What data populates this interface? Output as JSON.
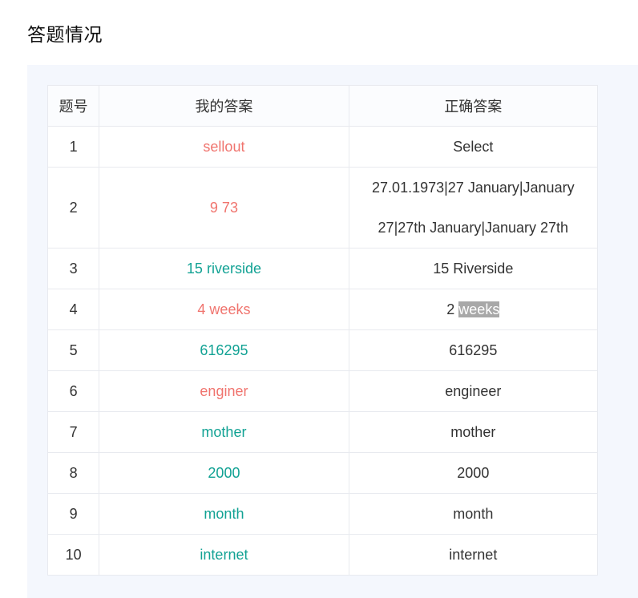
{
  "title": "答题情况",
  "colors": {
    "wrong": "#f0746e",
    "right": "#12a294",
    "panel_bg": "#f4f7fd",
    "highlight_bg": "#a8a8a8"
  },
  "table": {
    "headers": {
      "number": "题号",
      "my_answer": "我的答案",
      "correct_answer": "正确答案"
    },
    "rows": [
      {
        "number": "1",
        "my_answer": "sellout",
        "status": "wrong",
        "correct": "Select",
        "correct_highlight": ""
      },
      {
        "number": "2",
        "my_answer": "9 73",
        "status": "wrong",
        "correct": "27.01.1973|27 January|January 27|27th January|January 27th",
        "correct_highlight": ""
      },
      {
        "number": "3",
        "my_answer": "15 riverside",
        "status": "right",
        "correct": "15 Riverside",
        "correct_highlight": ""
      },
      {
        "number": "4",
        "my_answer": "4 weeks",
        "status": "wrong",
        "correct": "2 ",
        "correct_highlight": "weeks"
      },
      {
        "number": "5",
        "my_answer": "616295",
        "status": "right",
        "correct": "616295",
        "correct_highlight": ""
      },
      {
        "number": "6",
        "my_answer": "enginer",
        "status": "wrong",
        "correct": "engineer",
        "correct_highlight": ""
      },
      {
        "number": "7",
        "my_answer": "mother",
        "status": "right",
        "correct": "mother",
        "correct_highlight": ""
      },
      {
        "number": "8",
        "my_answer": "2000",
        "status": "right",
        "correct": "2000",
        "correct_highlight": ""
      },
      {
        "number": "9",
        "my_answer": "month",
        "status": "right",
        "correct": "month",
        "correct_highlight": ""
      },
      {
        "number": "10",
        "my_answer": "internet",
        "status": "right",
        "correct": "internet",
        "correct_highlight": ""
      }
    ]
  }
}
